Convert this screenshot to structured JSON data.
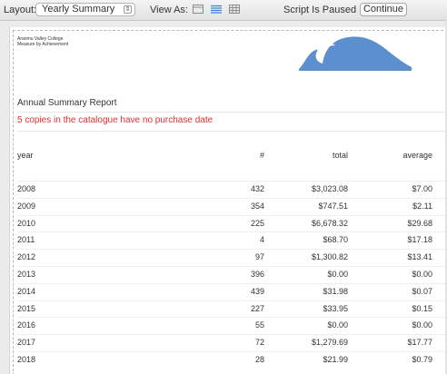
{
  "toolbar": {
    "layout_label": "Layout:",
    "layout_value": "Yearly Summary",
    "view_as_label": "View As:",
    "view_icons": [
      "form-view-icon",
      "list-view-icon",
      "table-view-icon"
    ],
    "status": "Script Is Paused",
    "continue_label": "Continue"
  },
  "report": {
    "org_line1": "Aranmu Valley College",
    "org_line2": "Measure by Achievement",
    "title": "Annual Summary Report",
    "warning": "5 copies in the catalogue have no purchase date",
    "columns": [
      "year",
      "#",
      "total",
      "average"
    ],
    "rows": [
      {
        "year": "2008",
        "count": "432",
        "total": "$3,023.08",
        "average": "$7.00"
      },
      {
        "year": "2009",
        "count": "354",
        "total": "$747.51",
        "average": "$2.11"
      },
      {
        "year": "2010",
        "count": "225",
        "total": "$6,678.32",
        "average": "$29.68"
      },
      {
        "year": "2011",
        "count": "4",
        "total": "$68.70",
        "average": "$17.18"
      },
      {
        "year": "2012",
        "count": "97",
        "total": "$1,300.82",
        "average": "$13.41"
      },
      {
        "year": "2013",
        "count": "396",
        "total": "$0.00",
        "average": "$0.00"
      },
      {
        "year": "2014",
        "count": "439",
        "total": "$31.98",
        "average": "$0.07"
      },
      {
        "year": "2015",
        "count": "227",
        "total": "$33.95",
        "average": "$0.15"
      },
      {
        "year": "2016",
        "count": "55",
        "total": "$0.00",
        "average": "$0.00"
      },
      {
        "year": "2017",
        "count": "72",
        "total": "$1,279.69",
        "average": "$17.77"
      },
      {
        "year": "2018",
        "count": "28",
        "total": "$21.99",
        "average": "$0.79"
      }
    ]
  },
  "colors": {
    "warning": "#e03030",
    "wave": "#5b8fcd"
  }
}
